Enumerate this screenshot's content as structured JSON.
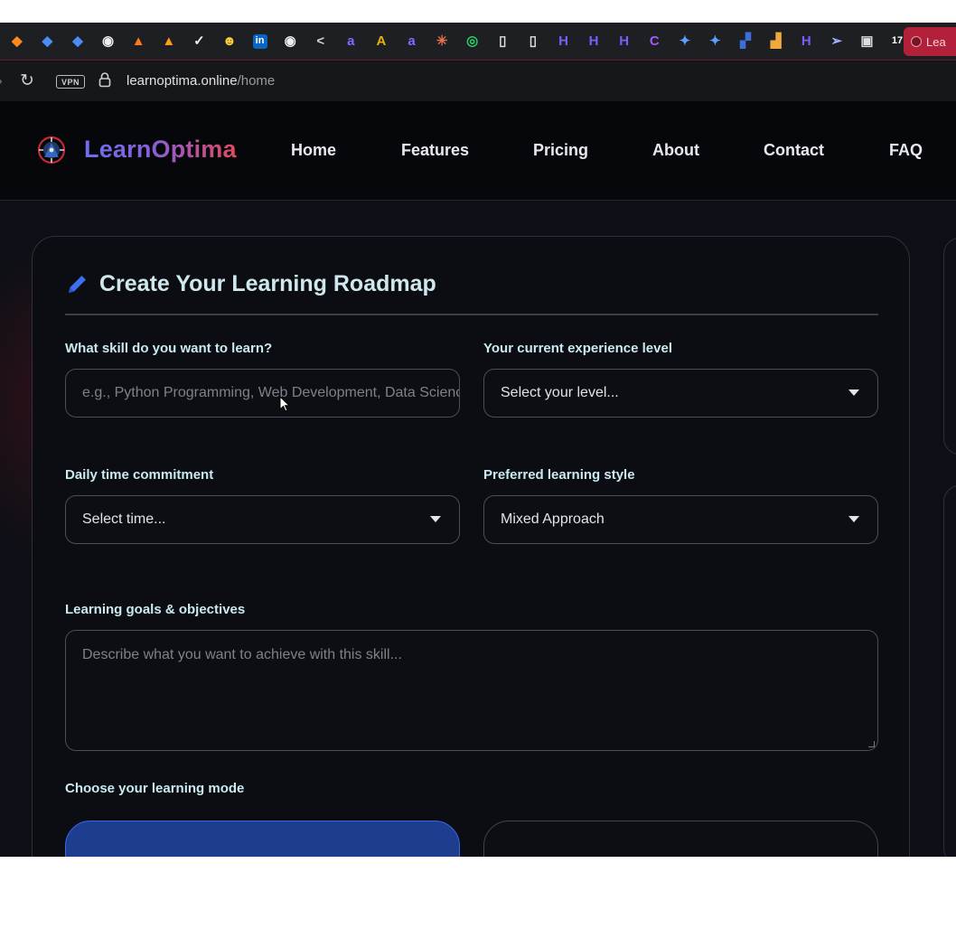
{
  "bookmarks": {
    "items": [
      {
        "icon": "shield-icon",
        "glyph": "◆",
        "color": "#ff8a1f"
      },
      {
        "icon": "shield-icon",
        "glyph": "◆",
        "color": "#4d8cf5"
      },
      {
        "icon": "shield-icon",
        "glyph": "◆",
        "color": "#4d8cf5"
      },
      {
        "icon": "github-icon",
        "glyph": "◉",
        "color": "#f0f0f0"
      },
      {
        "icon": "flame-icon",
        "glyph": "▲",
        "color": "#ff7a1a"
      },
      {
        "icon": "flame-icon",
        "glyph": "▲",
        "color": "#ff9a1a"
      },
      {
        "icon": "check-circle-icon",
        "glyph": "✓",
        "color": "#f0f0f0"
      },
      {
        "icon": "hugging-face-icon",
        "glyph": "☻",
        "color": "#ffcf3a"
      },
      {
        "icon": "linkedin-icon",
        "glyph": "in",
        "color": "#0a66c2"
      },
      {
        "icon": "github-icon",
        "glyph": "◉",
        "color": "#f0f0f0"
      },
      {
        "icon": "share-icon",
        "glyph": "<",
        "color": "#d0d0d0"
      },
      {
        "icon": "a-logo-icon",
        "glyph": "a",
        "color": "#7c6cff"
      },
      {
        "icon": "a-small-icon",
        "glyph": "A",
        "color": "#e6b200"
      },
      {
        "icon": "a-logo-icon",
        "glyph": "a",
        "color": "#7c6cff"
      },
      {
        "icon": "sparkle-orange-icon",
        "glyph": "✳",
        "color": "#e8734a"
      },
      {
        "icon": "whatsapp-icon",
        "glyph": "◎",
        "color": "#25d366"
      },
      {
        "icon": "document-icon",
        "glyph": "▯",
        "color": "#e0e0e0"
      },
      {
        "icon": "document-icon",
        "glyph": "▯",
        "color": "#e0e0e0"
      },
      {
        "icon": "h-logo-icon",
        "glyph": "H",
        "color": "#7b5cff"
      },
      {
        "icon": "h-logo-icon",
        "glyph": "H",
        "color": "#7b5cff"
      },
      {
        "icon": "h-logo-icon",
        "glyph": "H",
        "color": "#7b5cff"
      },
      {
        "icon": "c-logo-icon",
        "glyph": "C",
        "color": "#a259ff"
      },
      {
        "icon": "gemini-icon",
        "glyph": "✦",
        "color": "#5aa0ff"
      },
      {
        "icon": "gemini-icon",
        "glyph": "✦",
        "color": "#5aa0ff"
      },
      {
        "icon": "flag-icon",
        "glyph": "▞",
        "color": "#3c6fd8"
      },
      {
        "icon": "analytics-icon",
        "glyph": "▟",
        "color": "#f2a93b"
      },
      {
        "icon": "h-logo-icon",
        "glyph": "H",
        "color": "#7b5cff"
      },
      {
        "icon": "send-icon",
        "glyph": "➢",
        "color": "#9fb4ff"
      },
      {
        "icon": "shield-check-icon",
        "glyph": "▣",
        "color": "#dedede"
      },
      {
        "icon": "t-logo-icon",
        "glyph": "17",
        "color": "#ffffff"
      }
    ],
    "active_tab": "Lea"
  },
  "address_bar": {
    "vpn_label": "VPN",
    "url_host": "learnoptima.online",
    "url_path": "/home"
  },
  "site_nav": {
    "brand": "LearnOptima",
    "links": [
      "Home",
      "Features",
      "Pricing",
      "About",
      "Contact",
      "FAQ"
    ]
  },
  "form": {
    "title": "Create Your Learning Roadmap",
    "skill": {
      "label": "What skill do you want to learn?",
      "placeholder": "e.g., Python Programming, Web Development, Data Science",
      "value": ""
    },
    "experience": {
      "label": "Your current experience level",
      "selected": "Select your level..."
    },
    "time": {
      "label": "Daily time commitment",
      "selected": "Select time..."
    },
    "style": {
      "label": "Preferred learning style",
      "selected": "Mixed Approach"
    },
    "goals": {
      "label": "Learning goals & objectives",
      "placeholder": "Describe what you want to achieve with this skill..."
    },
    "mode": {
      "label": "Choose your learning mode"
    }
  },
  "colors": {
    "accent": "#3868e6",
    "label_text": "#c9eaf0",
    "background": "#0c0f16"
  }
}
